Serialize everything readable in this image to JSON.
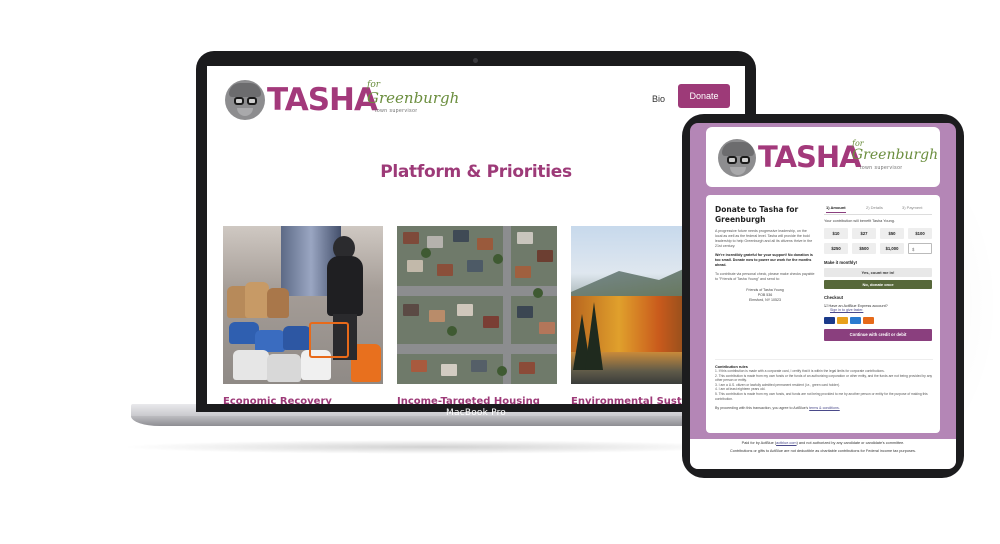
{
  "laptop": {
    "label": "MacBook Pro",
    "site": {
      "logo": {
        "name": "TASHA",
        "for": "for",
        "place": "Greenburgh",
        "subtitle": "town supervisor"
      },
      "nav": {
        "bio": "Bio",
        "donate": "Donate"
      },
      "page_title": "Platform & Priorities",
      "cards": [
        {
          "title": "Economic Recovery",
          "image": "volunteer-with-food-bags"
        },
        {
          "title": "Income-Targeted Housing",
          "image": "aerial-view-of-houses"
        },
        {
          "title": "Environmental Sustainability",
          "image": "autumn-lake-landscape"
        }
      ]
    }
  },
  "tablet": {
    "logo": {
      "name": "TASHA",
      "for": "for",
      "place": "Greenburgh",
      "subtitle": "town supervisor"
    },
    "form": {
      "heading": "Donate to Tasha for Greenburgh",
      "intro": "A progressive future needs progressive leadership, on the local as well as the federal level. Tasha will provide the bold leadership to help Greenburgh and all its citizens thrive in the 21st century.",
      "grateful": "We're incredibly grateful for your support! No donation is too small. Donate now to power our work for the months ahead.",
      "check_note": "To contribute via personal check, please make checks payable to \"Friends of Tasha Young\" and send to:",
      "address": [
        "Friends of Tasha Young",
        "POB 536",
        "Elmsford, NY 10523"
      ],
      "steps": [
        "1) Amount",
        "2) Details",
        "3) Payment"
      ],
      "benefit": "Your contribution will benefit Tasha Young.",
      "amounts": [
        "$10",
        "$27",
        "$50",
        "$100",
        "$250",
        "$500",
        "$1,000"
      ],
      "other_placeholder": "$",
      "monthly_label": "Make it monthly!",
      "yes_label": "Yes, count me in!",
      "no_label": "No, donate once",
      "checkout_label": "Checkout",
      "actblue_check": "Have an ActBlue Express account?",
      "signin_link": "Sign in to give faster.",
      "card_brands": [
        "VISA",
        "Mastercard",
        "AMEX",
        "Discover"
      ],
      "continue_label": "Continue with credit or debit",
      "contribution_rules_title": "Contribution rules",
      "rules": [
        "1. If this contribution is made with a corporate card, I certify that it is within the legal limits for corporate contributions.",
        "2. This contribution is made from my own funds or the funds of an authorizing corporation or other entity, and the funds are not being provided by any other person or entity.",
        "3. I am a U.S. citizen or lawfully admitted permanent resident (i.e., green card holder).",
        "4. I am at least eighteen years old.",
        "5. This contribution is made from my own funds, and funds are not being provided to me by another person or entity for the purpose of making this contribution."
      ],
      "agree_prefix": "By proceeding with this transaction, you agree to ActBlue's",
      "agree_link": "terms & conditions.",
      "footer_line1_prefix": "Paid for by ActBlue (",
      "footer_link": "actblue.com",
      "footer_line1_suffix": ") and not authorized by any candidate or candidate's committee.",
      "footer_line2": "Contributions or gifts to ActBlue are not deductible as charitable contributions for Federal income tax purposes."
    }
  },
  "colors": {
    "brand_purple": "#9d3a78",
    "brand_green": "#6b8e3e",
    "tablet_bg": "#b486b6",
    "no_button": "#57683a"
  }
}
